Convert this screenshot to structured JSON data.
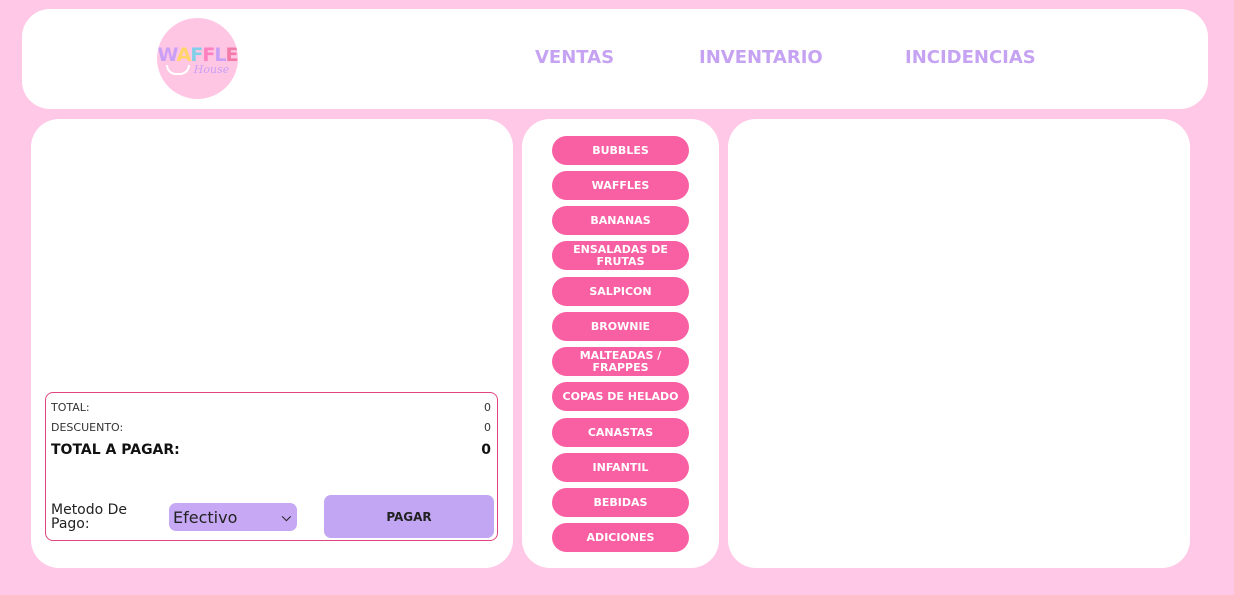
{
  "header": {
    "logo": {
      "word": [
        "W",
        "A",
        "F",
        "F",
        "L",
        "E"
      ],
      "script": "House"
    },
    "nav": [
      {
        "label": "VENTAS"
      },
      {
        "label": "INVENTARIO"
      },
      {
        "label": "INCIDENCIAS"
      }
    ]
  },
  "categories": [
    "BUBBLES",
    "WAFFLES",
    "BANANAS",
    "ENSALADAS DE FRUTAS",
    "SALPICON",
    "BROWNIE",
    "MALTEADAS / FRAPPES",
    "COPAS DE HELADO",
    "CANASTAS",
    "INFANTIL",
    "BEBIDAS",
    "ADICIONES"
  ],
  "totals": {
    "total_label": "TOTAL:",
    "total_value": "0",
    "discount_label": "DESCUENTO:",
    "discount_value": "0",
    "to_pay_label": "TOTAL A PAGAR:",
    "to_pay_value": "0"
  },
  "payment": {
    "label": "Metodo De Pago:",
    "method": "Efectivo",
    "pay_button": "PAGAR"
  },
  "colors": {
    "background": "#ffc8e6",
    "accent_pink": "#f95fa3",
    "accent_purple": "#c6a3f2"
  }
}
